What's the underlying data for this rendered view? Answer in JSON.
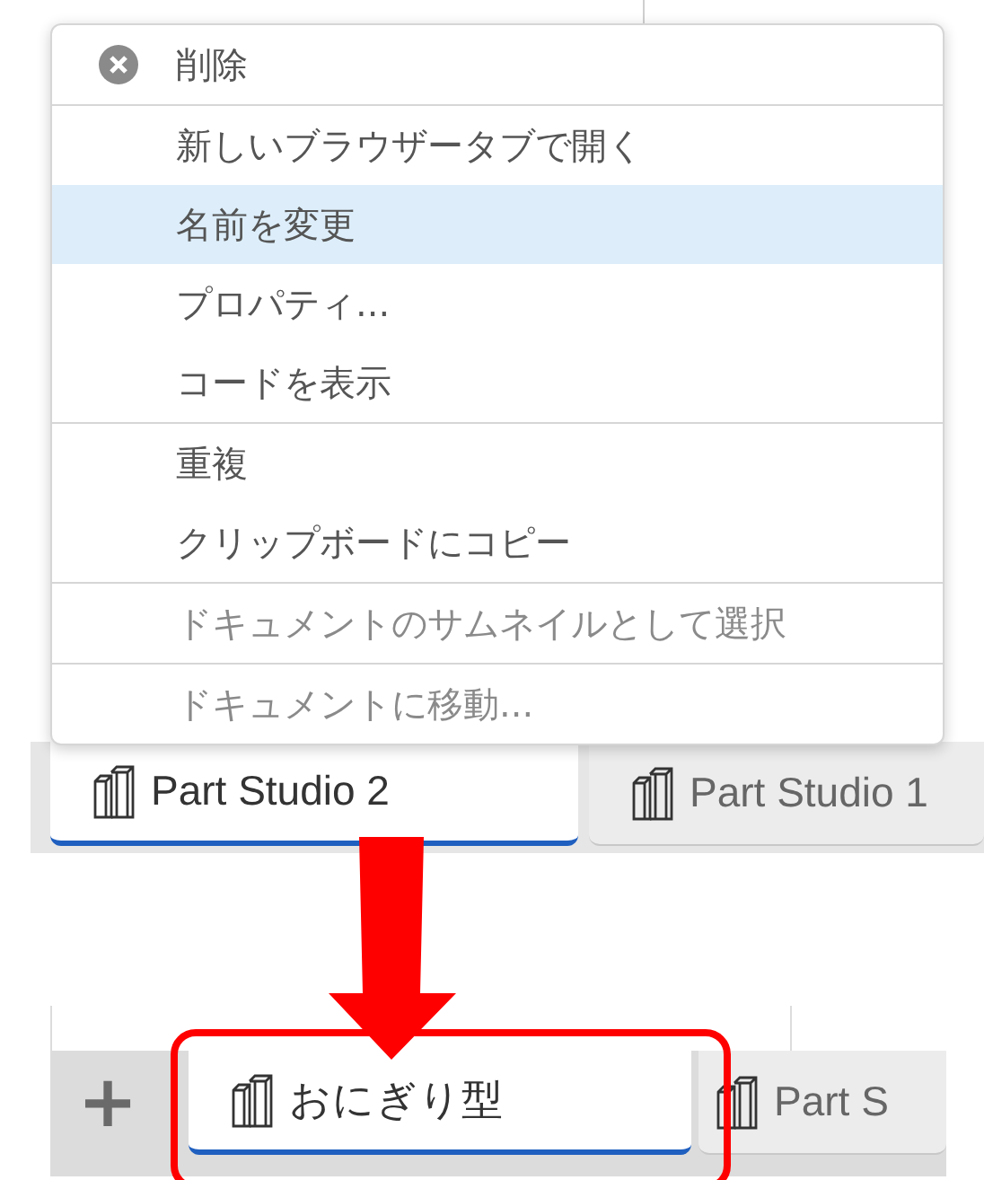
{
  "context_menu": {
    "sections": [
      [
        {
          "label": "削除",
          "kind": "icon",
          "highlighted": false,
          "disabled": false
        }
      ],
      [
        {
          "label": "新しいブラウザータブで開く",
          "kind": "plain",
          "highlighted": false,
          "disabled": false
        },
        {
          "label": "名前を変更",
          "kind": "plain",
          "highlighted": true,
          "disabled": false
        },
        {
          "label": "プロパティ...",
          "kind": "plain",
          "highlighted": false,
          "disabled": false
        },
        {
          "label": "コードを表示",
          "kind": "plain",
          "highlighted": false,
          "disabled": false
        }
      ],
      [
        {
          "label": "重複",
          "kind": "plain",
          "highlighted": false,
          "disabled": false
        },
        {
          "label": "クリップボードにコピー",
          "kind": "plain",
          "highlighted": false,
          "disabled": false
        }
      ],
      [
        {
          "label": "ドキュメントのサムネイルとして選択",
          "kind": "plain",
          "highlighted": false,
          "disabled": true
        }
      ],
      [
        {
          "label": "ドキュメントに移動...",
          "kind": "plain",
          "highlighted": false,
          "disabled": true
        }
      ]
    ]
  },
  "tabs_before": [
    {
      "label": "Part Studio 2",
      "selected": true
    },
    {
      "label": "Part Studio 1",
      "selected": false
    }
  ],
  "tabs_after": {
    "add_button": "+",
    "tabs": [
      {
        "label": "おにぎり型",
        "selected": true
      },
      {
        "label": "Part S",
        "selected": false
      }
    ]
  }
}
